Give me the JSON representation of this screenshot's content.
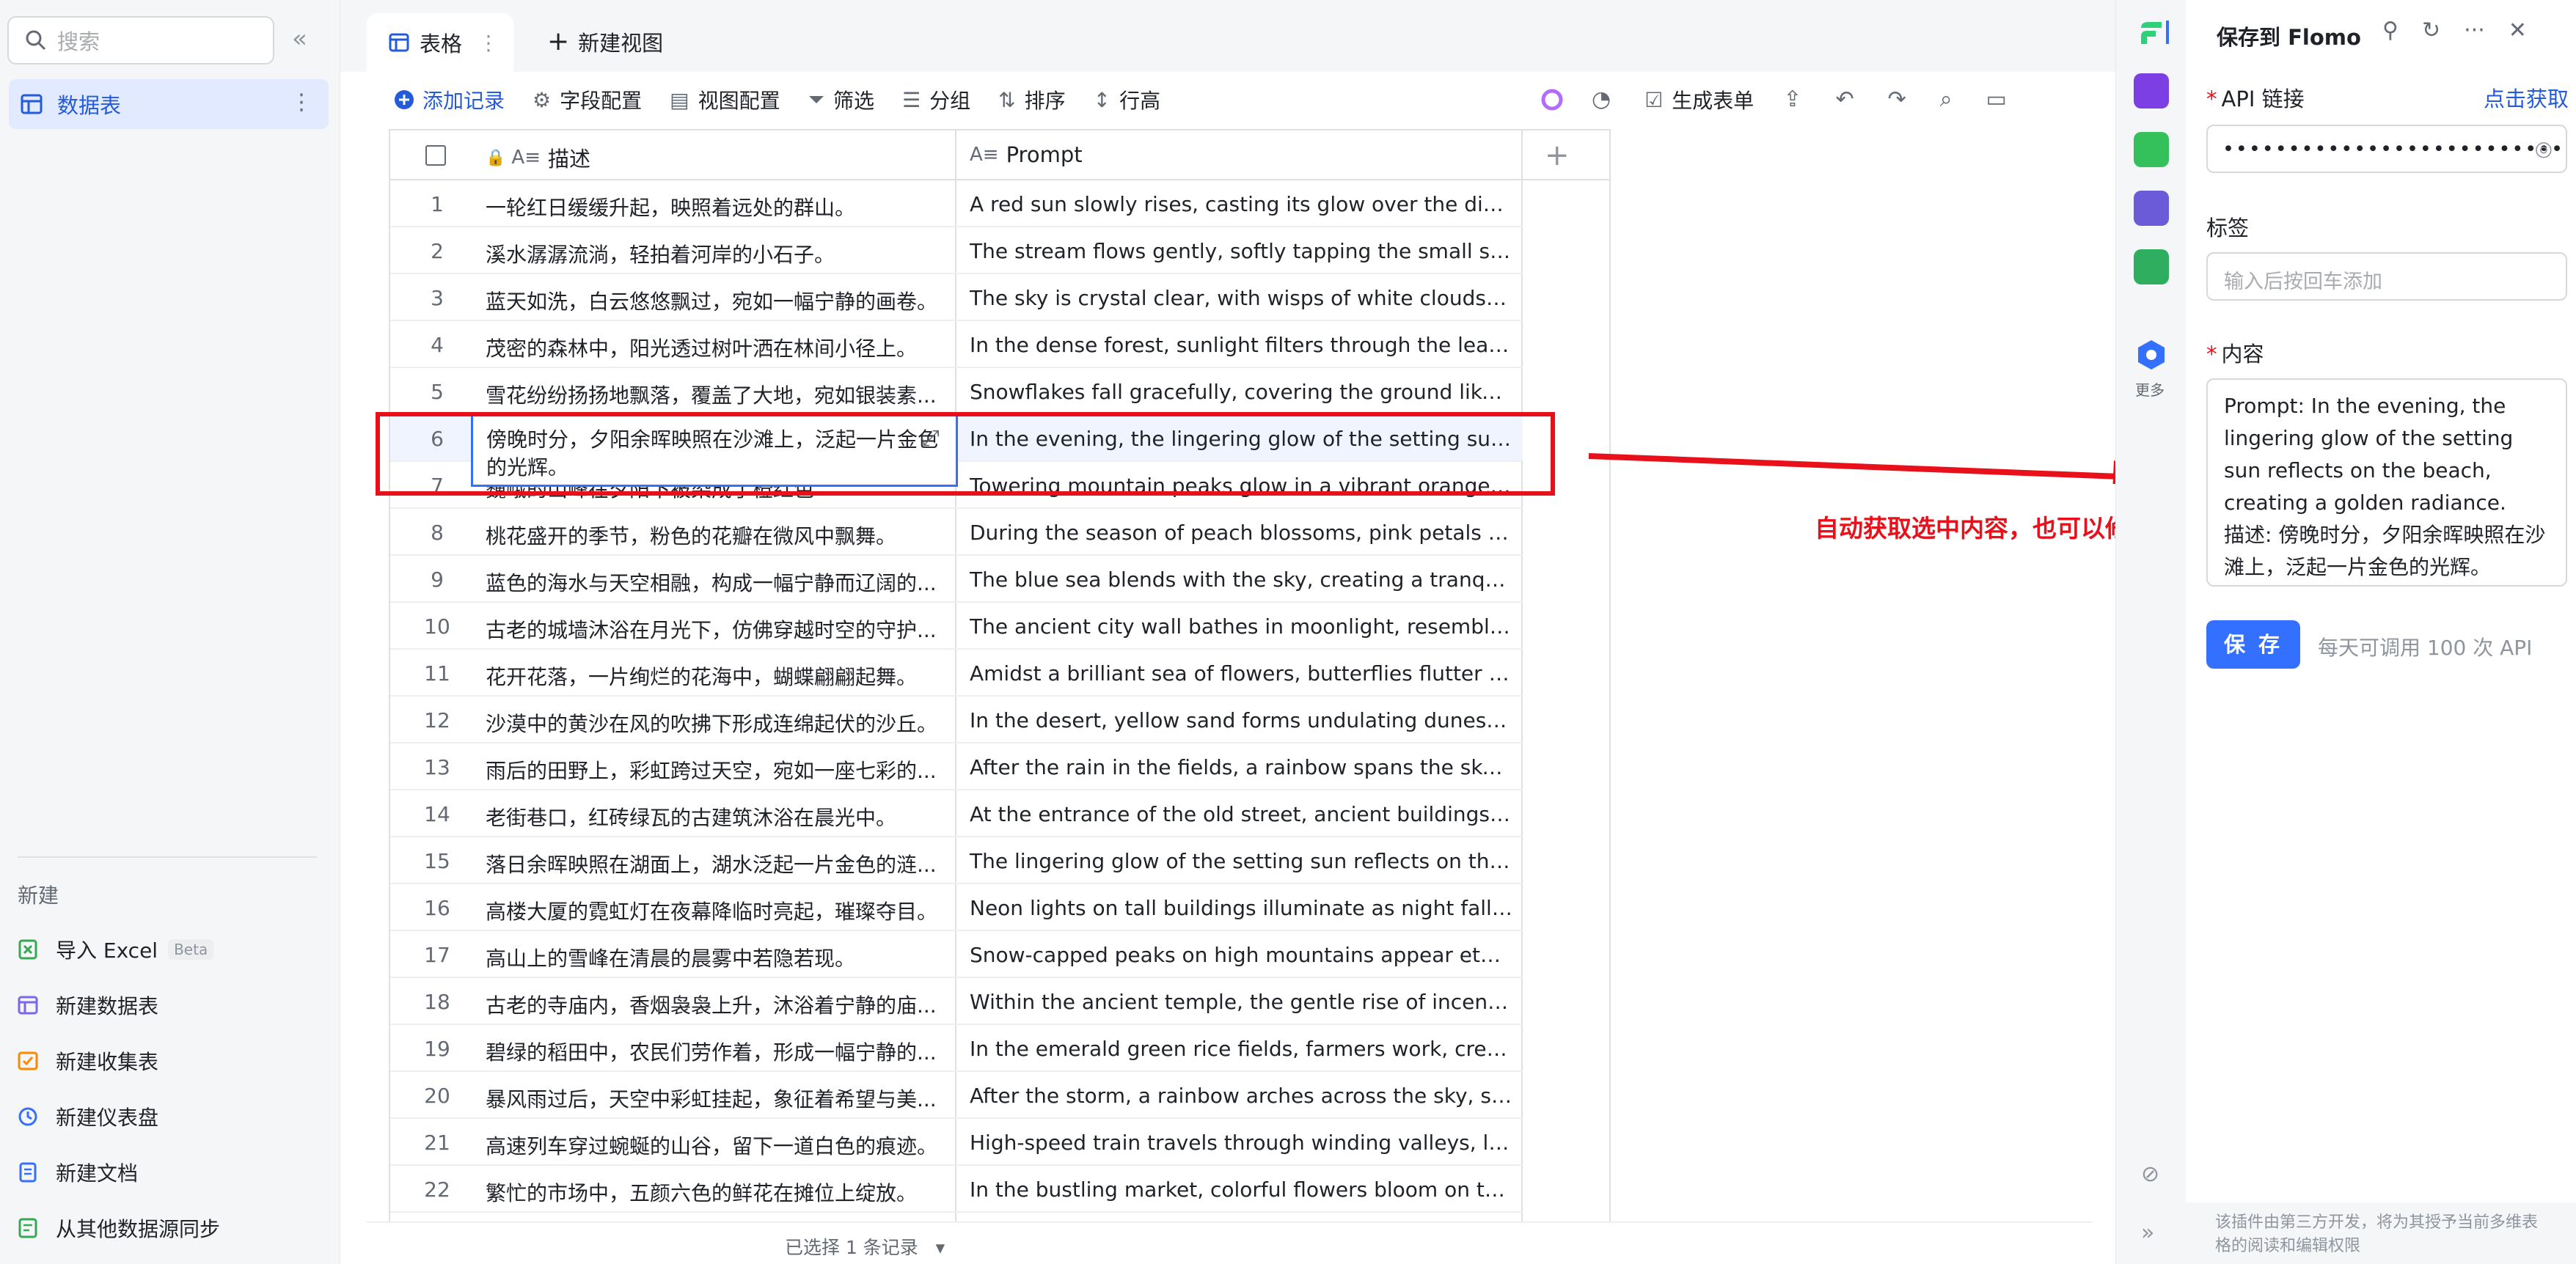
{
  "sidebar": {
    "search_placeholder": "搜索",
    "active_item": "数据表",
    "new_header": "新建",
    "new_items": [
      {
        "label": "导入 Excel",
        "badge": "Beta",
        "icon": "excel-icon",
        "color": "#34a853"
      },
      {
        "label": "新建数据表",
        "icon": "table-icon",
        "color": "#7b67ee"
      },
      {
        "label": "新建收集表",
        "icon": "form-icon",
        "color": "#ff8800"
      },
      {
        "label": "新建仪表盘",
        "icon": "dashboard-icon",
        "color": "#3370ff"
      },
      {
        "label": "新建文档",
        "icon": "doc-icon",
        "color": "#3370ff"
      },
      {
        "label": "从其他数据源同步",
        "icon": "sync-icon",
        "color": "#34a853"
      }
    ]
  },
  "tabs": {
    "active": "表格",
    "new_view": "新建视图"
  },
  "toolbar": {
    "add_record": "添加记录",
    "field_config": "字段配置",
    "view_config": "视图配置",
    "filter": "筛选",
    "group": "分组",
    "sort": "排序",
    "row_height": "行高",
    "generate_form": "生成表单"
  },
  "grid": {
    "columns": [
      "描述",
      "Prompt"
    ],
    "selected_row": 6,
    "active_cell_text": "傍晚时分，夕阳余晖映照在沙滩上，泛起一片金色的光辉。",
    "rows": [
      {
        "num": "1",
        "desc": "一轮红日缓缓升起，映照着远处的群山。",
        "prompt": "A red sun slowly rises, casting its glow over the distant ..."
      },
      {
        "num": "2",
        "desc": "溪水潺潺流淌，轻拍着河岸的小石子。",
        "prompt": "The stream flows gently, softly tapping the small stones..."
      },
      {
        "num": "3",
        "desc": "蓝天如洗，白云悠悠飘过，宛如一幅宁静的画卷。",
        "prompt": "The sky is crystal clear, with wisps of white clouds drifti..."
      },
      {
        "num": "4",
        "desc": "茂密的森林中，阳光透过树叶洒在林间小径上。",
        "prompt": "In the dense forest, sunlight filters through the leaves, ..."
      },
      {
        "num": "5",
        "desc": "雪花纷纷扬扬地飘落，覆盖了大地，宛如银装素...",
        "prompt": "Snowflakes fall gracefully, covering the ground like a sil..."
      },
      {
        "num": "6",
        "desc": "傍晚时分，夕阳余晖映照在沙滩上，泛起一片",
        "prompt": "In the evening, the lingering glow of the setting sun refl..."
      },
      {
        "num": "7",
        "desc": "巍峨的山峰在夕阳下被染成了橙红色",
        "prompt": "Towering mountain peaks glow in a vibrant orange hue ..."
      },
      {
        "num": "8",
        "desc": "桃花盛开的季节，粉色的花瓣在微风中飘舞。",
        "prompt": "During the season of peach blossoms, pink petals danc..."
      },
      {
        "num": "9",
        "desc": "蓝色的海水与天空相融，构成一幅宁静而辽阔的...",
        "prompt": "The blue sea blends with the sky, creating a tranquil an..."
      },
      {
        "num": "10",
        "desc": "古老的城墙沐浴在月光下，仿佛穿越时空的守护...",
        "prompt": "The ancient city wall bathes in moonlight, resembling a ..."
      },
      {
        "num": "11",
        "desc": "花开花落，一片绚烂的花海中，蝴蝶翩翩起舞。",
        "prompt": "Amidst a brilliant sea of flowers, butterflies flutter grace..."
      },
      {
        "num": "12",
        "desc": "沙漠中的黄沙在风的吹拂下形成连绵起伏的沙丘。",
        "prompt": "In the desert, yellow sand forms undulating dunes unde..."
      },
      {
        "num": "13",
        "desc": "雨后的田野上，彩虹跨过天空，宛如一座七彩的...",
        "prompt": "After the rain in the fields, a rainbow spans the sky, res..."
      },
      {
        "num": "14",
        "desc": "老街巷口，红砖绿瓦的古建筑沐浴在晨光中。",
        "prompt": "At the entrance of the old street, ancient buildings with ..."
      },
      {
        "num": "15",
        "desc": "落日余晖映照在湖面上，湖水泛起一片金色的涟...",
        "prompt": "The lingering glow of the setting sun reflects on the lak..."
      },
      {
        "num": "16",
        "desc": "高楼大厦的霓虹灯在夜幕降临时亮起，璀璨夺目。",
        "prompt": "Neon lights on tall buildings illuminate as night falls, da..."
      },
      {
        "num": "17",
        "desc": "高山上的雪峰在清晨的晨雾中若隐若现。",
        "prompt": "Snow-capped peaks on high mountains appear etherea..."
      },
      {
        "num": "18",
        "desc": "古老的寺庙内，香烟袅袅上升，沐浴着宁静的庙...",
        "prompt": "Within the ancient temple, the gentle rise of incense sm..."
      },
      {
        "num": "19",
        "desc": "碧绿的稻田中，农民们劳作着，形成一幅宁静的...",
        "prompt": "In the emerald green rice fields, farmers work, creating ..."
      },
      {
        "num": "20",
        "desc": "暴风雨过后，天空中彩虹挂起，象征着希望与美...",
        "prompt": "After the storm, a rainbow arches across the sky, symb..."
      },
      {
        "num": "21",
        "desc": "高速列车穿过蜿蜒的山谷，留下一道白色的痕迹。",
        "prompt": "High-speed train travels through winding valleys, leavin..."
      },
      {
        "num": "22",
        "desc": "繁忙的市场中，五颜六色的鲜花在摊位上绽放。",
        "prompt": "In the bustling market, colorful flowers bloom on the st..."
      }
    ]
  },
  "status": {
    "selected_text": "已选择 1 条记录"
  },
  "annotation": {
    "note": "自动获取选中内容，也可以修改",
    "color": "#e8101a"
  },
  "strip": {
    "more_label": "更多"
  },
  "panel": {
    "title": "保存到 Flomo",
    "api_label": "API 链接",
    "api_get": "点击获取",
    "api_value": "••••••••••••••••••••••••••••••••••",
    "tags_label": "标签",
    "tags_placeholder": "输入后按回车添加",
    "content_label": "内容",
    "content_text": "Prompt: In the evening, the lingering glow of the setting sun reflects on the beach, creating a golden radiance.\n描述: 傍晚时分，夕阳余晖映照在沙滩上，泛起一片金色的光辉。",
    "save_label": "保 存",
    "quota": "每天可调用 100 次 API",
    "footer": "该插件由第三方开发，将为其授予当前多维表格的阅读和编辑权限"
  },
  "colors": {
    "accent": "#3370ff",
    "accent_text": "#245bdb",
    "selected_row_bg": "#f0f4ff"
  }
}
